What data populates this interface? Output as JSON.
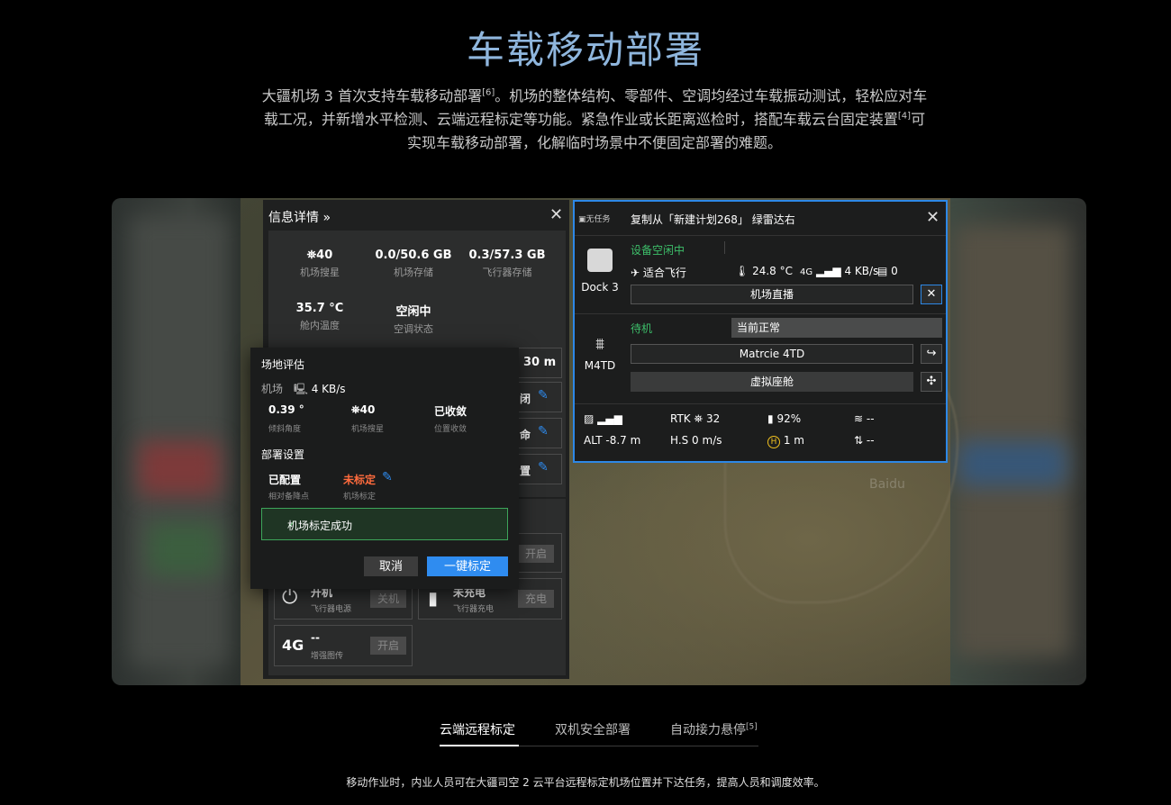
{
  "hero": {
    "title": "车载移动部署",
    "desc_part1": "大疆机场 3 首次支持车载移动部署",
    "ref1": "[6]",
    "desc_part2": "。机场的整体结构、零部件、空调均经过车载振动测试，轻松应对车载工况，并新增水平检测、云端远程标定等功能。紧急作业或长距离巡检时，搭配车载云台固定装置",
    "ref2": "[4]",
    "desc_part3": "可实现车载移动部署，化解临时场景中不便固定部署的难题。"
  },
  "left_panel": {
    "title": "信息详情 »",
    "close": "✕",
    "stats": [
      {
        "value": "40",
        "label": "机场搜星"
      },
      {
        "value": "0.0/50.6 GB",
        "label": "机场存储"
      },
      {
        "value": "0.3/57.3 GB",
        "label": "飞行器存储"
      },
      {
        "value": "35.7 °C",
        "label": "舱内温度"
      },
      {
        "value": "空闲中",
        "label": "空调状态"
      }
    ],
    "partial_values": [
      "30 m",
      "闭",
      "命",
      "置"
    ],
    "devices": [
      {
        "icon": "⏻",
        "name": "开机",
        "sub": "飞行器电源",
        "btn": "关机"
      },
      {
        "icon": "▮",
        "name": "未充电",
        "sub": "飞行器充电",
        "btn": "充电"
      },
      {
        "icon": "4G",
        "name": "--",
        "sub": "增强图传",
        "btn": "开启"
      }
    ],
    "hidden_btn": "开启"
  },
  "dialog": {
    "title": "场地评估",
    "net_label": "机场",
    "net_value": "4 KB/s",
    "items": [
      {
        "value": "0.39 °",
        "label": "倾斜角度"
      },
      {
        "value": "40",
        "label": "机场搜星"
      },
      {
        "value": "已收敛",
        "label": "位置收敛"
      }
    ],
    "section": "部署设置",
    "deploy": [
      {
        "value": "已配置",
        "label": "相对备降点"
      },
      {
        "value": "未标定",
        "label": "机场标定"
      }
    ],
    "success": "机场标定成功",
    "cancel": "取消",
    "confirm": "一键标定"
  },
  "right_panel": {
    "tag": "无任务",
    "title": "复制从「新建计划268」 绿雷达右",
    "close": "✕",
    "dock": {
      "name": "Dock 3",
      "status": "设备空闲中",
      "flight": "适合飞行",
      "temp": "24.8 °C",
      "net": "4G",
      "speed": "4 KB/s",
      "count": "0",
      "live_btn": "机场直播"
    },
    "drone": {
      "name": "M4TD",
      "status": "待机",
      "state": "当前正常",
      "model": "Matrcie 4TD",
      "cockpit": "虚拟座舱"
    },
    "telemetry": {
      "rtk": "RTK",
      "rtk_value": "32",
      "battery": "92%",
      "wind": "--",
      "alt": "ALT -8.7 m",
      "hs": "H.S 0 m/s",
      "home_dist": "1 m",
      "vs": "--"
    }
  },
  "tabs": {
    "items": [
      "云端远程标定",
      "双机安全部署",
      "自动接力悬停"
    ],
    "ref": "[5]",
    "caption": "移动作业时，内业人员可在大疆司空 2 云平台远程标定机场位置并下达任务，提高人员和调度效率。"
  },
  "map": {
    "watermark": "Baidu"
  },
  "colors": {
    "accent": "#2f8cf0",
    "success": "#3dbf6a",
    "warning": "#ff6b3d",
    "title": "#8fb6dd"
  }
}
